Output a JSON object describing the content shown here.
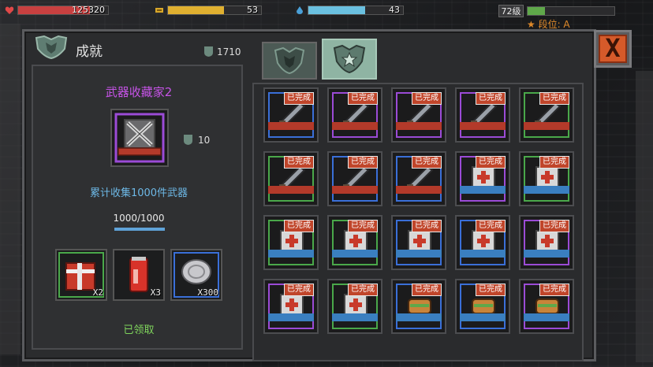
{
  "hud": {
    "hp_value": "125320",
    "energy_value": "53",
    "water_value": "43",
    "level_label": "72级",
    "rank_label": "段位: A",
    "hp_fill": 0.8,
    "energy_fill": 0.6,
    "water_fill": 0.6,
    "xp_fill": 0.2
  },
  "window": {
    "title": "成就",
    "points": "1710",
    "close_label": "X",
    "tabs": [
      {
        "icon": "shield-badge-icon",
        "active": false
      },
      {
        "icon": "star-shield-icon",
        "active": true
      }
    ]
  },
  "detail": {
    "name": "武器收藏家2",
    "reward_points": "10",
    "description": "累计收集1000件武器",
    "progress_text": "1000/1000",
    "progress_fill": 1.0,
    "rewards": [
      {
        "icon": "red-crate-icon",
        "qty": "X2"
      },
      {
        "icon": "soda-can-icon",
        "qty": "X3"
      },
      {
        "icon": "silver-coin-icon",
        "qty": "X300"
      }
    ],
    "claim_status": "已领取"
  },
  "grid": {
    "completed_label": "已完成",
    "rows": [
      [
        {
          "frame": "#3a6fd8",
          "art": "weapon",
          "ribbon": "#b33a2a",
          "done": true
        },
        {
          "frame": "#9b4bd6",
          "art": "weapon",
          "ribbon": "#b33a2a",
          "done": true
        },
        {
          "frame": "#9b4bd6",
          "art": "weapon",
          "ribbon": "#b33a2a",
          "done": true
        },
        {
          "frame": "#9b4bd6",
          "art": "weapon",
          "ribbon": "#b33a2a",
          "done": true
        },
        {
          "frame": "#4aa84a",
          "art": "weapon",
          "ribbon": "#b33a2a",
          "done": true
        }
      ],
      [
        {
          "frame": "#4aa84a",
          "art": "weapon",
          "ribbon": "#b33a2a",
          "done": true
        },
        {
          "frame": "#3a6fd8",
          "art": "weapon",
          "ribbon": "#b33a2a",
          "done": true
        },
        {
          "frame": "#3a6fd8",
          "art": "weapon",
          "ribbon": "#b33a2a",
          "done": true
        },
        {
          "frame": "#9b4bd6",
          "art": "medkit",
          "ribbon": "#3a7fc0",
          "done": true
        },
        {
          "frame": "#4aa84a",
          "art": "medkit",
          "ribbon": "#3a7fc0",
          "done": true
        }
      ],
      [
        {
          "frame": "#4aa84a",
          "art": "medkit",
          "ribbon": "#3a7fc0",
          "done": true
        },
        {
          "frame": "#4aa84a",
          "art": "medkit",
          "ribbon": "#3a7fc0",
          "done": true
        },
        {
          "frame": "#3a6fd8",
          "art": "medkit",
          "ribbon": "#3a7fc0",
          "done": true
        },
        {
          "frame": "#3a6fd8",
          "art": "medkit",
          "ribbon": "#3a7fc0",
          "done": true
        },
        {
          "frame": "#9b4bd6",
          "art": "medkit",
          "ribbon": "#3a7fc0",
          "done": true
        }
      ],
      [
        {
          "frame": "#9b4bd6",
          "art": "medkit",
          "ribbon": "#3a7fc0",
          "done": true
        },
        {
          "frame": "#4aa84a",
          "art": "medkit",
          "ribbon": "#3a7fc0",
          "done": true
        },
        {
          "frame": "#3a6fd8",
          "art": "food",
          "ribbon": "#3a7fc0",
          "done": true
        },
        {
          "frame": "#3a6fd8",
          "art": "food",
          "ribbon": "#3a7fc0",
          "done": true
        },
        {
          "frame": "#9b4bd6",
          "art": "food",
          "ribbon": "#3a7fc0",
          "done": true
        }
      ]
    ]
  }
}
